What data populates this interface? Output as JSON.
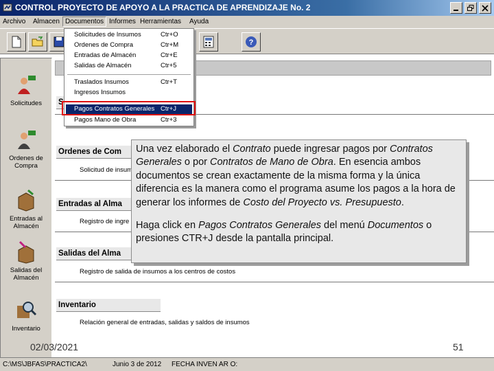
{
  "window": {
    "app_name": "CONTROL",
    "title": "PROYECTO DE APOYO A LA PRACTICA DE APRENDIZAJE No. 2"
  },
  "menubar": [
    "Archivo",
    "Almacen",
    "Documentos",
    "Informes",
    "Herramientas",
    "Ayuda"
  ],
  "dropdown": {
    "items": [
      {
        "label": "Solicitudes de Insumos",
        "shortcut": "Ctr+O"
      },
      {
        "label": "Ordenes de Compra",
        "shortcut": "Ctr+M"
      },
      {
        "label": "Entradas de Almacén",
        "shortcut": "Ctr+E"
      },
      {
        "label": "Salidas de Almacén",
        "shortcut": "Ctr+5"
      },
      {
        "label": "Traslados Insumos",
        "shortcut": "Ctr+T"
      },
      {
        "label": "Ingresos Insumos",
        "shortcut": ""
      },
      {
        "label": "Pagos Contratos Generales",
        "shortcut": "Ctr+J"
      },
      {
        "label": "Pagos Mano de Obra",
        "shortcut": "Ctr+3"
      }
    ]
  },
  "sidebar": [
    "Solicitudes",
    "Ordenes de Compra",
    "Entradas al Almacén",
    "Salidas del Almacén",
    "Inventario"
  ],
  "sections": [
    {
      "title": "S",
      "desc": ""
    },
    {
      "title": "Ordenes de Com",
      "desc": "Solicitud de insum"
    },
    {
      "title": "Entradas al Alma",
      "desc": "Registro de ingre"
    },
    {
      "title": "Salidas del Alma",
      "desc": "Registro de salida de insumos a los centros de costos"
    },
    {
      "title": "Inventario",
      "desc": "Relación general de entradas, salidas y saldos de insumos"
    }
  ],
  "callout": {
    "p1_a": "Una vez elaborado el ",
    "p1_b": "Contrato",
    "p1_c": " puede ingresar pagos por ",
    "p1_d": "Contratos Generales",
    "p1_e": " o por ",
    "p1_f": "Contratos de Mano de Obra",
    "p1_g": ". En esencia ambos documentos se crean exactamente de la misma forma y la única diferencia es la manera como el programa asume los pagos a la hora de generar los informes de ",
    "p1_h": "Costo del Proyecto vs. Presupuesto",
    "p1_i": ".",
    "p2_a": "Haga click en ",
    "p2_b": "Pagos Contratos Generales",
    "p2_c": " del menú ",
    "p2_d": "Documentos",
    "p2_e": " o presiones CTR+J desde la pantalla principal."
  },
  "statusbar": {
    "path": "C:\\MS\\JBFAS\\PRACTICA2\\",
    "date": "Junio 3 de 2012",
    "inventory": "FECHA INVEN    AR O:"
  },
  "slide": {
    "date": "02/03/2021",
    "number": "51"
  },
  "colors": {
    "titlebar": "#0a246a",
    "highlight": "#e01010",
    "selected": "#0a246a"
  }
}
